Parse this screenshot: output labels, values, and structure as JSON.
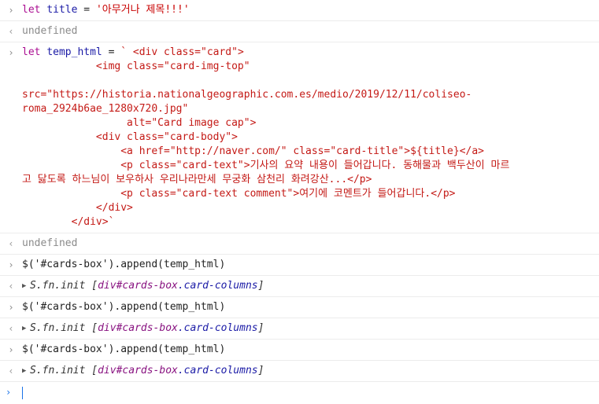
{
  "icons": {
    "input_prompt": "›",
    "result_arrow": "‹",
    "expand_triangle": "▶"
  },
  "colors": {
    "keyword": "#aa0d91",
    "identifier": "#1a1aa6",
    "string": "#c80000",
    "muted": "#8a8a8a",
    "prompt": "#1a73e8"
  },
  "entries": [
    {
      "keyword": "let",
      "name": "title",
      "op": " = ",
      "value": "'아무거나 제목!!!'"
    },
    {
      "result": "undefined"
    },
    {
      "keyword": "let",
      "name": "temp_html",
      "op": " = ",
      "template_lines": [
        "` <div class=\"card\">",
        "            <img class=\"card-img-top\"",
        "",
        "src=\"https://historia.nationalgeographic.com.es/medio/2019/12/11/coliseo-",
        "roma_2924b6ae_1280x720.jpg\"",
        "                 alt=\"Card image cap\">",
        "            <div class=\"card-body\">",
        "                <a href=\"http://naver.com/\" class=\"card-title\">${title}</a>",
        "                <p class=\"card-text\">기사의 요약 내용이 들어갑니다. 동해물과 백두산이 마르",
        "고 닳도록 하느님이 보우하사 우리나라만세 무궁화 삼천리 화려강산...</p>",
        "                <p class=\"card-text comment\">여기에 코멘트가 들어갑니다.</p>",
        "            </div>",
        "        </div>`"
      ]
    },
    {
      "result": "undefined"
    },
    {
      "command": "$('#cards-box').append(temp_html)"
    },
    {
      "object_prefix": "S.fn.init ",
      "object_open": "[",
      "object_id": "div#cards-box",
      "object_cls": ".card-columns",
      "object_close": "]"
    },
    {
      "command": "$('#cards-box').append(temp_html)"
    },
    {
      "object_prefix": "S.fn.init ",
      "object_open": "[",
      "object_id": "div#cards-box",
      "object_cls": ".card-columns",
      "object_close": "]"
    },
    {
      "command": "$('#cards-box').append(temp_html)"
    },
    {
      "object_prefix": "S.fn.init ",
      "object_open": "[",
      "object_id": "div#cards-box",
      "object_cls": ".card-columns",
      "object_close": "]"
    }
  ]
}
